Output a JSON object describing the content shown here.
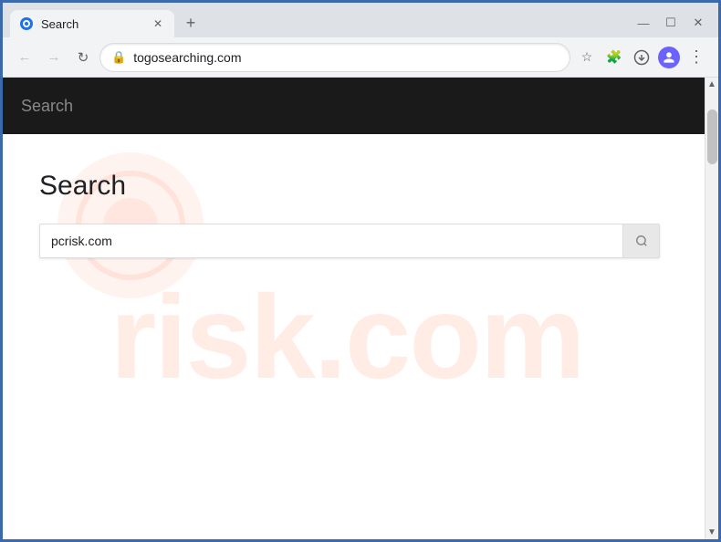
{
  "browser": {
    "tab": {
      "title": "Search",
      "favicon": "globe-icon"
    },
    "new_tab_label": "+",
    "window_controls": {
      "minimize": "—",
      "maximize": "☐",
      "close": "✕"
    },
    "address_bar": {
      "url": "togosearching.com",
      "back_label": "←",
      "forward_label": "→",
      "refresh_label": "↻",
      "bookmark_label": "☆",
      "extensions_label": "🧩",
      "profile_label": "👤",
      "menu_label": "⋮",
      "download_label": "⬇"
    }
  },
  "site": {
    "header_title": "Search",
    "page_heading": "Search",
    "search_input_value": "pcrisk.com",
    "search_input_placeholder": "pcrisk.com",
    "watermark_text": "risk.com"
  }
}
